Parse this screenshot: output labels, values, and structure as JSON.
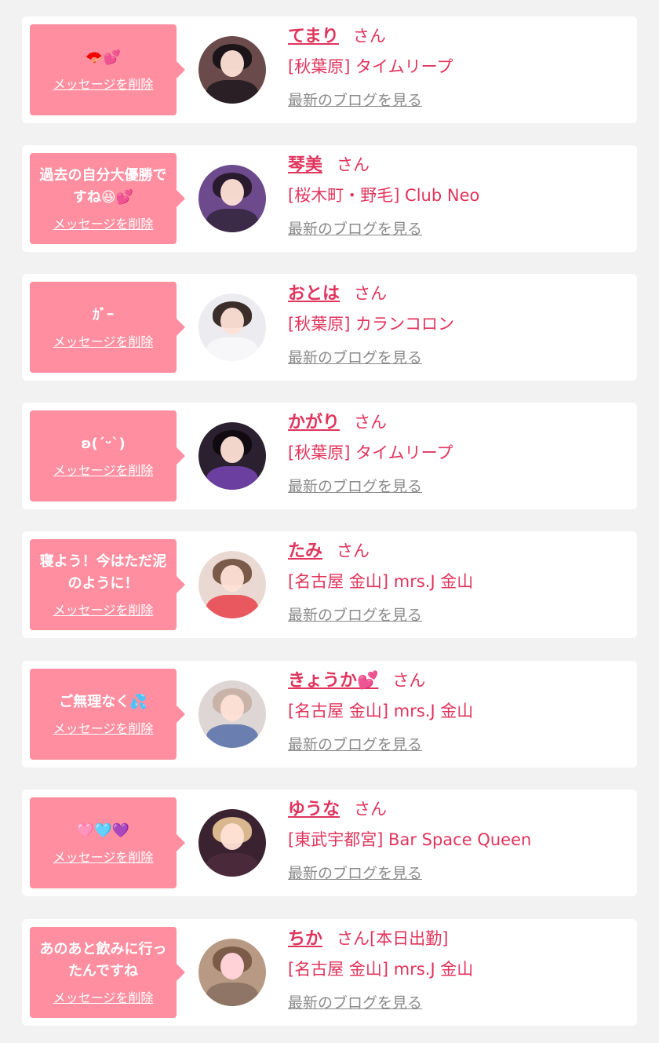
{
  "common": {
    "delete_label": "メッセージを削除",
    "blog_label": "最新のブログを見る",
    "san": "さん"
  },
  "colors": {
    "bubble": "#ff8fa0",
    "accent": "#e0345c",
    "link_gray": "#8a8a8a",
    "background": "#f2f2f2"
  },
  "messages": [
    {
      "message": "🪭💕",
      "name": "てまり",
      "suffix": "さん",
      "shop": "[秋葉原] タイムリープ"
    },
    {
      "message": "過去の自分大優勝ですね😆💕",
      "name": "琴美",
      "suffix": "さん",
      "shop": "[桜木町・野毛] Club Neo"
    },
    {
      "message": "ｶﾞｰ",
      "name": "おとは",
      "suffix": "さん",
      "shop": "[秋葉原] カランコロン"
    },
    {
      "message": "ʚ(ˊᵕˋ)",
      "name": "かがり",
      "suffix": "さん",
      "shop": "[秋葉原] タイムリープ"
    },
    {
      "message": "寝よう！今はただ泥のように！",
      "name": "たみ",
      "suffix": "さん",
      "shop": "[名古屋 金山] mrs.J 金山"
    },
    {
      "message": "ご無理なく💦",
      "name": "きょうか💕",
      "suffix": "さん",
      "shop": "[名古屋 金山] mrs.J 金山"
    },
    {
      "message": "🩷🩵💜",
      "name": "ゆうな",
      "suffix": "さん",
      "shop": "[東武宇都宮] Bar Space Queen"
    },
    {
      "message": "あのあと飲みに行ったんですね",
      "name": "ちか",
      "suffix": "さん[本日出勤]",
      "shop": "[名古屋 金山] mrs.J 金山"
    }
  ]
}
